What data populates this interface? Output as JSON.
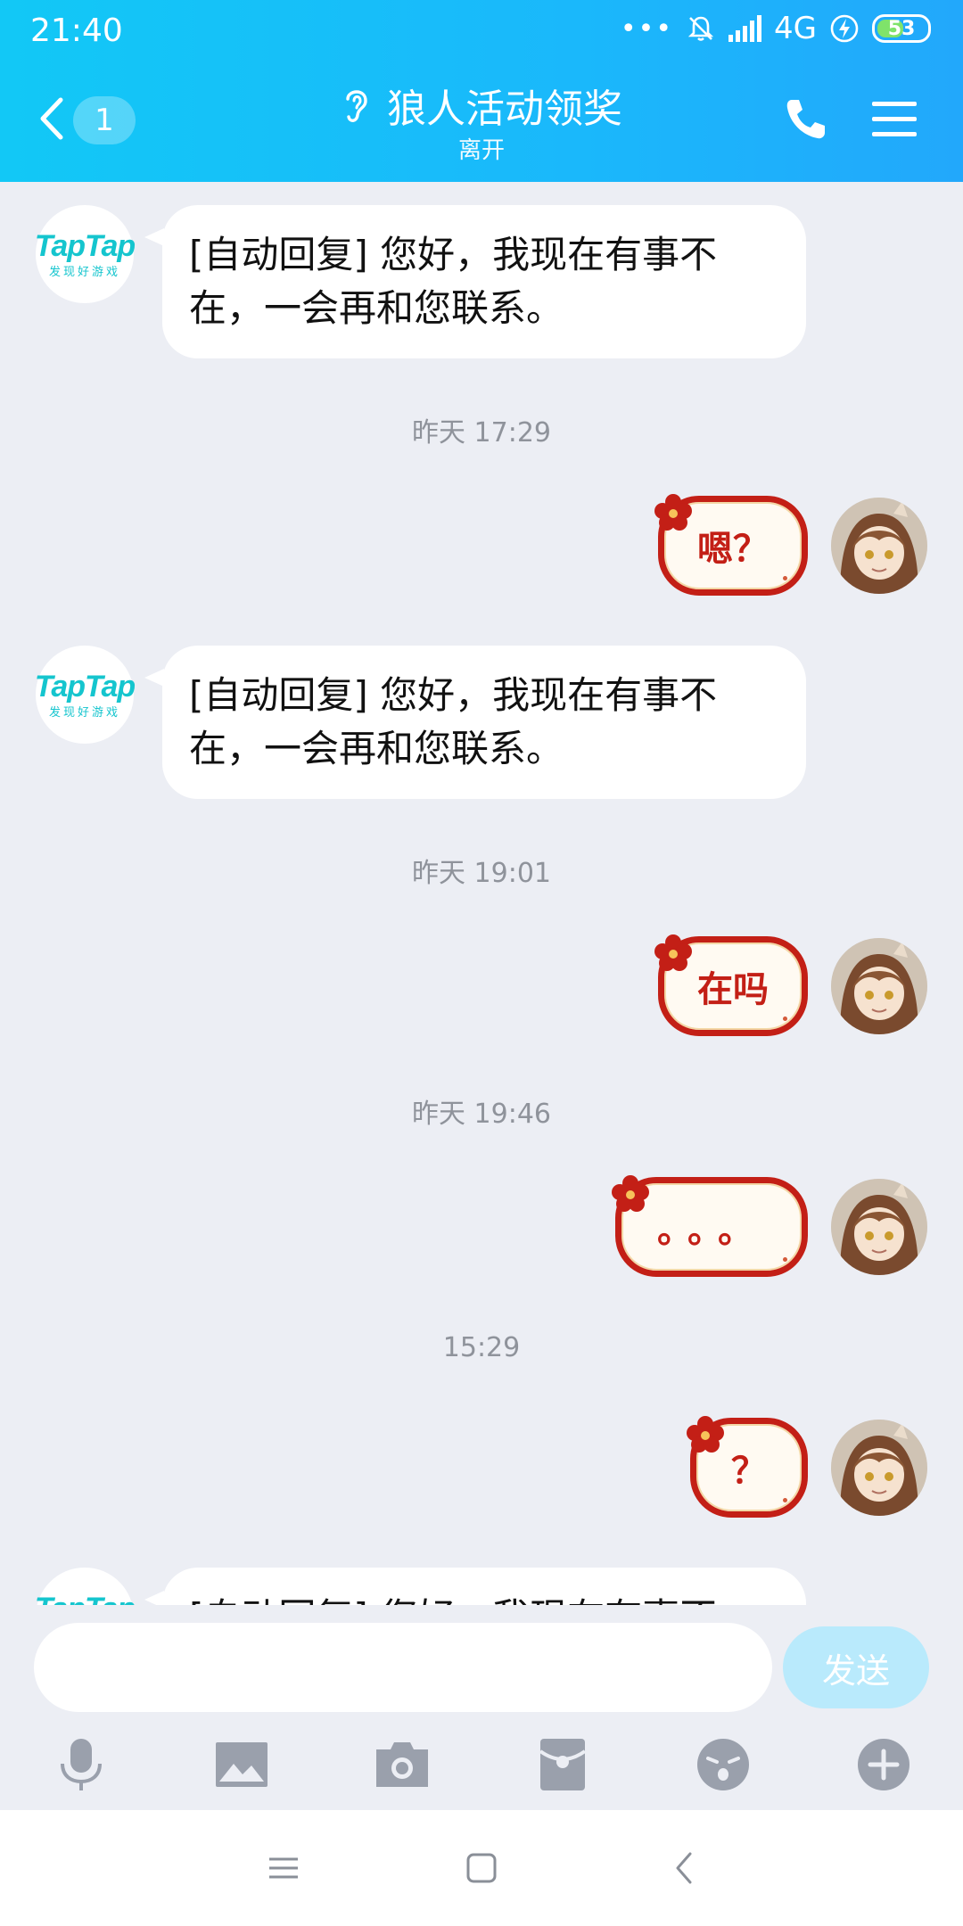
{
  "status_bar": {
    "time": "21:40",
    "dots": "•••",
    "network": "4G",
    "battery": "53",
    "battery_level": 0.53
  },
  "header": {
    "unread_count": "1",
    "title": "狼人活动领奖",
    "subtitle": "离开",
    "icons": [
      "back-icon",
      "ear-icon",
      "phone-icon",
      "menu-icon"
    ]
  },
  "contact": {
    "avatar_brand": "TapTap",
    "avatar_slogan": "发现好游戏"
  },
  "messages": [
    {
      "type": "incoming",
      "text": "[自动回复] 您好，我现在有事不在，一会再和您联系。"
    },
    {
      "type": "timestamp",
      "text": "昨天 17:29"
    },
    {
      "type": "outgoing-sticker",
      "text": "嗯？"
    },
    {
      "type": "incoming",
      "text": "[自动回复] 您好，我现在有事不在，一会再和您联系。"
    },
    {
      "type": "timestamp",
      "text": "昨天 19:01"
    },
    {
      "type": "outgoing-sticker",
      "text": "在吗"
    },
    {
      "type": "timestamp",
      "text": "昨天 19:46"
    },
    {
      "type": "outgoing-sticker",
      "text": "。。。"
    },
    {
      "type": "timestamp",
      "text": "15:29"
    },
    {
      "type": "outgoing-sticker",
      "text": "？"
    },
    {
      "type": "incoming",
      "text": "[自动回复] 您好，我现在有事不在，一会再和您联系。"
    }
  ],
  "input": {
    "placeholder": "",
    "send_label": "发送"
  },
  "toolbar": [
    "microphone-icon",
    "image-icon",
    "camera-icon",
    "red-packet-icon",
    "emoji-icon",
    "plus-icon"
  ],
  "colors": {
    "header_start": "#12c8f6",
    "header_end": "#22a8fb",
    "background": "#eceef4",
    "sticker_red": "#c31f16",
    "taptap_teal": "#15c5ce",
    "send_disabled": "#b9eafc"
  }
}
